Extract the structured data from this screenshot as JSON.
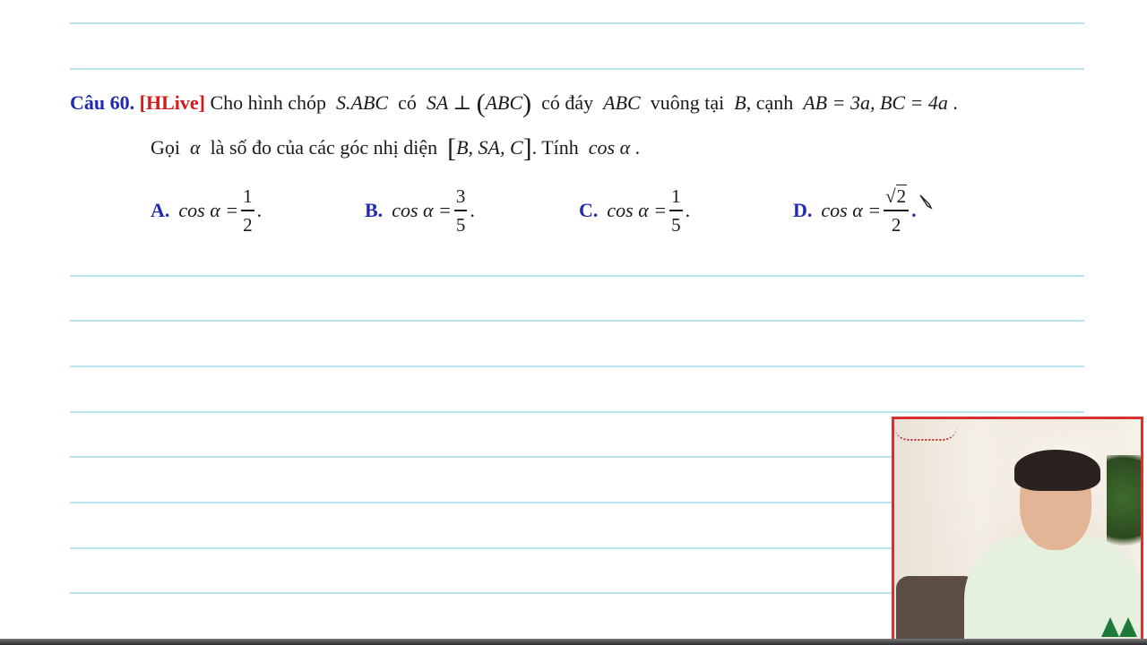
{
  "question": {
    "number": "Câu 60.",
    "tag": "[HLive]",
    "t1": "Cho hình chóp",
    "pyramid": "S.ABC",
    "t2": "có",
    "perp_left": "SA ⊥ ",
    "paren_l": "(",
    "perp_plane": "ABC",
    "paren_r": ")",
    "t3": "có đáy",
    "base": "ABC",
    "t4": "vuông tại",
    "vertex": "B",
    "t5": ", cạnh",
    "lengths": "AB = 3a, BC = 4a",
    "end": ".",
    "t6": "Gọi",
    "alpha": "α",
    "t7": "là số đo của các góc nhị diện",
    "br_l": "[",
    "dihedral": "B, SA, C",
    "br_r": "]",
    "t8": ". Tính",
    "target": "cos α",
    "end2": "."
  },
  "options": [
    {
      "letter": "A.",
      "lhs": "cos α =",
      "num": "1",
      "den": "2",
      "end": "."
    },
    {
      "letter": "B.",
      "lhs": "cos α =",
      "num": "3",
      "den": "5",
      "end": "."
    },
    {
      "letter": "C.",
      "lhs": "cos α =",
      "num": "1",
      "den": "5",
      "end": "."
    },
    {
      "letter": "D.",
      "lhs": "cos α =",
      "num_radical": "√",
      "num": "2",
      "den": "2",
      "end": "."
    }
  ],
  "colors": {
    "rule": "#b9e3ee",
    "label_blue": "#1f2bb4",
    "tag_red": "#d11a1a"
  },
  "icons": [
    "cursor-pen-icon",
    "christmas-tree-icon"
  ]
}
